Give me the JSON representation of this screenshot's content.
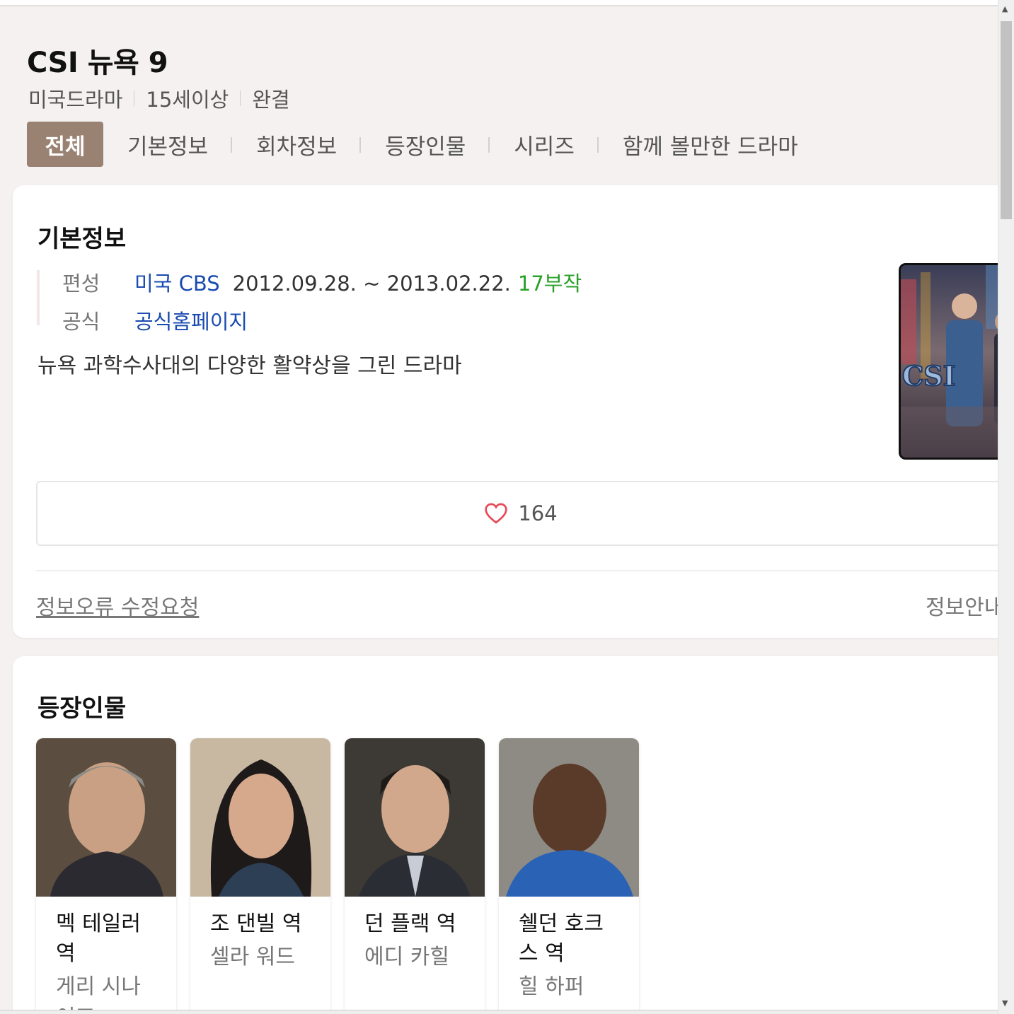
{
  "header": {
    "title": "CSI 뉴욕 9",
    "meta": [
      "미국드라마",
      "15세이상",
      "완결"
    ]
  },
  "tabs": [
    "전체",
    "기본정보",
    "회차정보",
    "등장인물",
    "시리즈",
    "함께 볼만한 드라마"
  ],
  "basic_info": {
    "heading": "기본정보",
    "broadcast_label": "편성",
    "broadcast_channel": "미국 CBS",
    "broadcast_dates": "2012.09.28. ~ 2013.02.22.",
    "episodes": "17부작",
    "official_label": "공식",
    "official_link": "공식홈페이지",
    "description": "뉴욕 과학수사대의 다양한 활약상을 그린 드라마",
    "poster_text": "CSI"
  },
  "like": {
    "count": "164"
  },
  "footer": {
    "report": "정보오류 수정요청",
    "guide": "정보안내"
  },
  "cast_section": {
    "heading": "등장인물",
    "members": [
      {
        "role": "멕 테일러 역",
        "actor": "게리 시나이즈"
      },
      {
        "role": "조 댄빌 역",
        "actor": "셀라 워드"
      },
      {
        "role": "던 플랙 역",
        "actor": "에디 카힐"
      },
      {
        "role": "쉘던 호크스 역",
        "actor": "힐 하퍼"
      }
    ]
  },
  "colors": {
    "active_tab": "#9a8273",
    "link": "#1a4bb0",
    "episodes": "#2aa12a",
    "heart": "#e94a5a"
  }
}
